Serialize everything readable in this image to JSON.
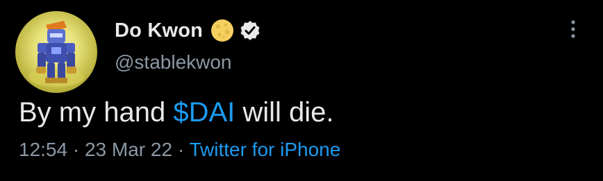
{
  "colors": {
    "background": "#000000",
    "primary_text": "#e7e9ea",
    "secondary_text": "#8b98a5",
    "link": "#1d9bf0",
    "verified_badge": "#e7e9ea",
    "emoji_badge": "#f5d061"
  },
  "author": {
    "avatar_icon": "robot-avatar",
    "display_name": "Do Kwon",
    "emoji_badge_icon": "full-moon-face-emoji",
    "verified_icon": "verified-badge-icon",
    "handle": "@stablekwon"
  },
  "more_button_icon": "vertical-ellipsis-icon",
  "tweet": {
    "text_before": "By my hand ",
    "cashtag": "$DAI",
    "text_after": " will die."
  },
  "meta": {
    "time": "12:54",
    "separator": " · ",
    "date": "23 Mar 22",
    "separator2": " · ",
    "source": "Twitter for iPhone"
  }
}
